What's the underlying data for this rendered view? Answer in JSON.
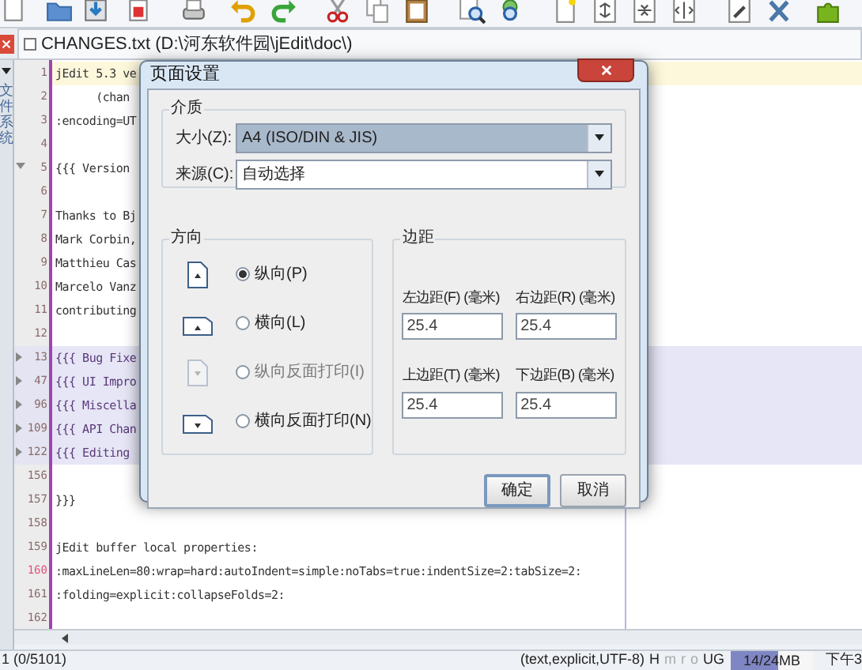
{
  "file_tab": {
    "title": "CHANGES.txt (D:\\河东软件园\\jEdit\\doc\\)"
  },
  "sidebar_tab": {
    "label": "文件系统"
  },
  "editor": {
    "lines": [
      {
        "number": "1",
        "text": "jEdit 5.3 ve",
        "folded": false,
        "fold_open": false,
        "highlight": true,
        "current": false
      },
      {
        "number": "2",
        "text": "      (chan",
        "folded": false,
        "fold_open": false,
        "highlight": false,
        "current": false
      },
      {
        "number": "3",
        "text": ":encoding=UT",
        "folded": false,
        "fold_open": false,
        "highlight": false,
        "current": false
      },
      {
        "number": "4",
        "folded": false,
        "fold_open": false,
        "highlight": false,
        "current": false
      },
      {
        "number": "5",
        "text": "{{{ Version",
        "folded": false,
        "fold_open": true,
        "highlight": false,
        "current": false
      },
      {
        "number": "6",
        "folded": false,
        "fold_open": false,
        "highlight": false,
        "current": false
      },
      {
        "number": "7",
        "text": "Thanks to Bj",
        "folded": false,
        "fold_open": false,
        "highlight": false,
        "current": false
      },
      {
        "number": "8",
        "text": "Mark Corbin,",
        "folded": false,
        "fold_open": false,
        "highlight": false,
        "current": false
      },
      {
        "number": "9",
        "text": "Matthieu Cas",
        "folded": false,
        "fold_open": false,
        "highlight": false,
        "current": false
      },
      {
        "number": "10",
        "text": "Marcelo Vanz",
        "folded": false,
        "fold_open": false,
        "highlight": false,
        "current": false
      },
      {
        "number": "11",
        "text": "contributing",
        "folded": false,
        "fold_open": false,
        "highlight": false,
        "current": false
      },
      {
        "number": "12",
        "folded": false,
        "fold_open": false,
        "highlight": false,
        "current": false
      },
      {
        "number": "13",
        "text": "{{{ Bug Fixe",
        "folded": true,
        "fold_open": false,
        "highlight": false,
        "current": false
      },
      {
        "number": "47",
        "text": "{{{ UI Impro",
        "folded": true,
        "fold_open": false,
        "highlight": false,
        "current": false
      },
      {
        "number": "96",
        "text": "{{{ Miscella",
        "folded": true,
        "fold_open": false,
        "highlight": false,
        "current": false
      },
      {
        "number": "109",
        "text": "{{{ API Chan",
        "folded": true,
        "fold_open": false,
        "highlight": false,
        "current": false
      },
      {
        "number": "122",
        "text": "{{{ Editing",
        "folded": true,
        "fold_open": false,
        "highlight": false,
        "current": false
      },
      {
        "number": "156",
        "folded": false,
        "fold_open": false,
        "highlight": false,
        "current": false
      },
      {
        "number": "157",
        "text": "}}}",
        "folded": false,
        "fold_open": false,
        "highlight": false,
        "current": false
      },
      {
        "number": "158",
        "folded": false,
        "fold_open": false,
        "highlight": false,
        "current": false
      },
      {
        "number": "159",
        "text": "jEdit buffer local properties:",
        "folded": false,
        "fold_open": false,
        "highlight": false,
        "current": false
      },
      {
        "number": "160",
        "text": ":maxLineLen=80:wrap=hard:autoIndent=simple:noTabs=true:indentSize=2:tabSize=2:",
        "folded": false,
        "fold_open": false,
        "highlight": false,
        "current": true
      },
      {
        "number": "161",
        "text": ":folding=explicit:collapseFolds=2:",
        "folded": false,
        "fold_open": false,
        "highlight": false,
        "current": false
      },
      {
        "number": "162",
        "folded": false,
        "fold_open": false,
        "highlight": false,
        "current": false
      }
    ]
  },
  "dialog": {
    "title": "页面设置",
    "media": {
      "title": "介质",
      "size": {
        "label": "大小(Z):",
        "value": "A4 (ISO/DIN & JIS)"
      },
      "source": {
        "label": "来源(C):",
        "value": "自动选择"
      }
    },
    "orientation": {
      "title": "方向",
      "options": [
        {
          "kind": "portrait",
          "label": "纵向(P)",
          "selected": true,
          "disabled": false
        },
        {
          "kind": "landscape",
          "label": "横向(L)",
          "selected": false,
          "disabled": false
        },
        {
          "kind": "reverse_portrait",
          "label": "纵向反面打印(I)",
          "selected": false,
          "disabled": true
        },
        {
          "kind": "reverse_landscape",
          "label": "横向反面打印(N)",
          "selected": false,
          "disabled": false
        }
      ]
    },
    "margins": {
      "title": "边距",
      "fields": [
        {
          "label": "左边距(F) (毫米)",
          "value": "25.4"
        },
        {
          "label": "右边距(R) (毫米)",
          "value": "25.4"
        },
        {
          "label": "上边距(T) (毫米)",
          "value": "25.4"
        },
        {
          "label": "下边距(B) (毫米)",
          "value": "25.4"
        }
      ]
    },
    "buttons": [
      {
        "label": "确定",
        "default": true
      },
      {
        "label": "取消",
        "default": false
      }
    ]
  },
  "status_bar": {
    "position": "1 (0/5101)",
    "mode": "(text,explicit,UTF-8)",
    "flags": [
      {
        "text": "H",
        "enabled": true
      },
      {
        "text": "m",
        "enabled": false
      },
      {
        "text": "r",
        "enabled": false
      },
      {
        "text": "o",
        "enabled": false
      },
      {
        "text": "UG",
        "enabled": true
      }
    ],
    "memory": {
      "text": "14/24MB",
      "level": 0.58
    },
    "time": "下午3"
  }
}
